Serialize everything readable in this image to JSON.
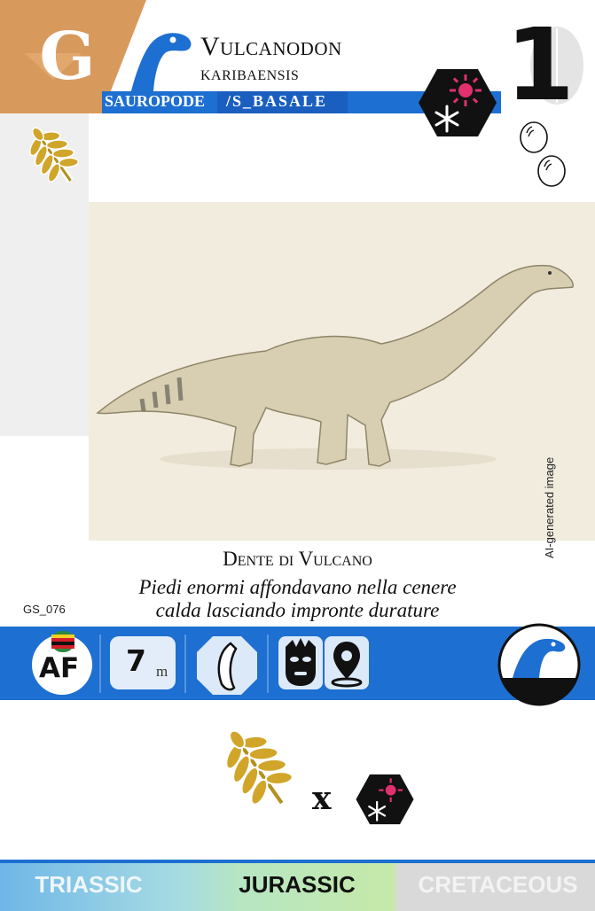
{
  "header": {
    "group_letter": "G",
    "name_line1": "Vulcanodon",
    "name_line2": "karibaensis",
    "clade": "SAUROPODE",
    "subclade": "/S_BASALE",
    "number": "1",
    "colors": {
      "corner": "#d89a5c",
      "band": "#1d6fd1",
      "hexagon": "#111111",
      "sun": "#e0306e"
    }
  },
  "icons": {
    "diet": "herbivore-leaf-icon",
    "climate": "sun-snowflake-hexagon-icon",
    "eggs": "egg-icon",
    "silhouette": "sauropod-head-icon"
  },
  "egg_count": 2,
  "illustration": {
    "subject": "sauropod-illustration",
    "ai_note": "AI-generated image"
  },
  "card": {
    "common_name": "Dente di Vulcano",
    "description_line1": "Piedi enormi affondavano nella cenere",
    "description_line2": "calda lasciando impronte durature",
    "id": "GS_076"
  },
  "info_bar": {
    "region": "AF",
    "flag": "zimbabwe-flag-icon",
    "length_value": "7",
    "length_unit": "m",
    "claw_icon": "claw-icon",
    "mask_icon": "tribal-mask-icon",
    "location_icon": "map-pin-icon"
  },
  "combo": {
    "multiplier": "x"
  },
  "periods": {
    "items": [
      {
        "label": "TRIASSIC",
        "active": false
      },
      {
        "label": "JURASSIC",
        "active": true
      },
      {
        "label": "CRETACEOUS",
        "active": false
      }
    ]
  }
}
